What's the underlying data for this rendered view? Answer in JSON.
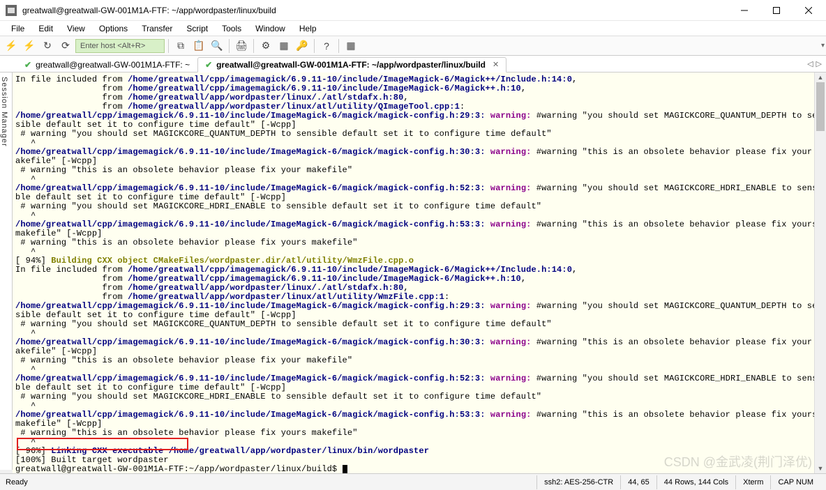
{
  "title": "greatwall@greatwall-GW-001M1A-FTF: ~/app/wordpaster/linux/build",
  "menu": {
    "file": "File",
    "edit": "Edit",
    "view": "View",
    "options": "Options",
    "transfer": "Transfer",
    "script": "Script",
    "tools": "Tools",
    "window": "Window",
    "help": "Help"
  },
  "toolbar": {
    "host_placeholder": "Enter host <Alt+R>"
  },
  "tabs": {
    "t1": "greatwall@greatwall-GW-001M1A-FTF: ~",
    "t2": "greatwall@greatwall-GW-001M1A-FTF: ~/app/wordpaster/linux/build"
  },
  "session_mgr": "Session Manager",
  "term": {
    "in_from": "In file included from ",
    "from": "                 from ",
    "inc1": "/home/greatwall/cpp/imagemagick/6.9.11-10/include/ImageMagick-6/Magick++/Include.h:14:0",
    "inc2": "/home/greatwall/cpp/imagemagick/6.9.11-10/include/ImageMagick-6/Magick++.h:10",
    "inc3": "/home/greatwall/app/wordpaster/linux/./atl/stdafx.h:80",
    "inc4": "/home/greatwall/app/wordpaster/linux/atl/utility/QImageTool.cpp:1",
    "cfg29": "/home/greatwall/cpp/imagemagick/6.9.11-10/include/ImageMagick-6/magick/magick-config.h:29:3:",
    "cfg30": "/home/greatwall/cpp/imagemagick/6.9.11-10/include/ImageMagick-6/magick/magick-config.h:30:3:",
    "cfg52": "/home/greatwall/cpp/imagemagick/6.9.11-10/include/ImageMagick-6/magick/magick-config.h:52:3:",
    "cfg53": "/home/greatwall/cpp/imagemagick/6.9.11-10/include/ImageMagick-6/magick/magick-config.h:53:3:",
    "warn": "warning:",
    "msg_qd": " #warning \"you should set MAGICKCORE_QUANTUM_DEPTH to sensible default set it to configure time default\" [-Wcpp]",
    "msg_qd2": " # warning \"you should set MAGICKCORE_QUANTUM_DEPTH to sensible default set it to configure time default\"",
    "caret": "   ^",
    "msg_ob": " #warning \"this is an obsolete behavior please fix your makefile\" [-Wcpp]",
    "msg_ob2": " # warning \"this is an obsolete behavior please fix your makefile\"",
    "msg_hd": " #warning \"you should set MAGICKCORE_HDRI_ENABLE to sensible default set it to configure time default\" [-Wcpp]",
    "msg_hd2": " # warning \"you should set MAGICKCORE_HDRI_ENABLE to sensible default set it to configure time default\"",
    "msg_obs": " #warning \"this is an obsolete behavior please fix yours makefile\" [-Wcpp]",
    "msg_obs2": " # warning \"this is an obsolete behavior please fix yours makefile\"",
    "p94": "[ 94%] ",
    "p94b": "Building CXX object CMakeFiles/wordpaster.dir/atl/utility/WmzFile.cpp.o",
    "inc4b": "/home/greatwall/app/wordpaster/linux/atl/utility/WmzFile.cpp:1",
    "p96": "[ 96%] ",
    "p96b": "Linking CXX executable /home/greatwall/app/wordpaster/linux/bin/wordpaster",
    "p100": "[100%] Built target wordpaster",
    "prompt": "greatwall@greatwall-GW-001M1A-FTF:~/app/wordpaster/linux/build$ "
  },
  "status": {
    "ready": "Ready",
    "ssh": "ssh2: AES-256-CTR",
    "pos": "44, 65",
    "rowcol": "44 Rows, 144 Cols",
    "term_type": "Xterm",
    "caps": "CAP  NUM"
  },
  "watermark": "CSDN @金武凌(荆门泽优)"
}
